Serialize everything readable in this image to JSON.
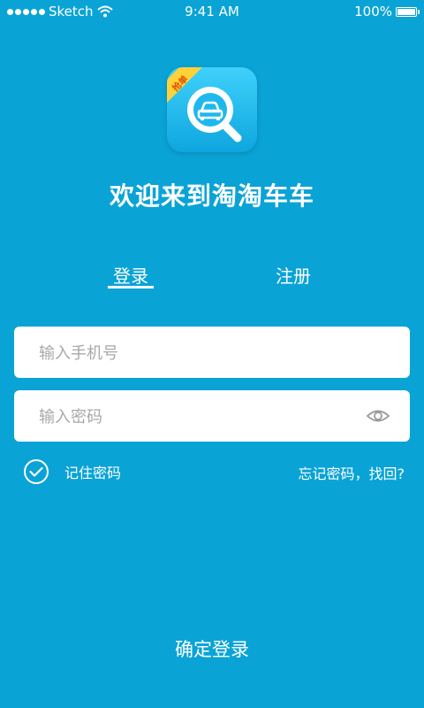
{
  "status_bar": {
    "carrier": "Sketch",
    "time": "9:41 AM",
    "battery": "100%",
    "battery_level": 1.0
  },
  "app": {
    "badge": "抢单",
    "welcome": "欢迎来到淘淘车车"
  },
  "tabs": [
    {
      "label": "登录",
      "active": true
    },
    {
      "label": "注册",
      "active": false
    }
  ],
  "form": {
    "phone_placeholder": "输入手机号",
    "phone_value": "",
    "password_placeholder": "输入密码",
    "password_value": "",
    "remember_label": "记住密码",
    "remember_checked": true,
    "forgot_label": "忘记密码，找回?"
  },
  "actions": {
    "confirm_label": "确定登录"
  },
  "colors": {
    "background": "#0aa3d6",
    "badge": "#ffd23a",
    "logo": "#1fb8ee"
  },
  "icons": {
    "eye": "eye-icon",
    "check": "check-circle-icon",
    "wifi": "wifi-icon",
    "car": "car-icon",
    "search": "search-icon"
  }
}
